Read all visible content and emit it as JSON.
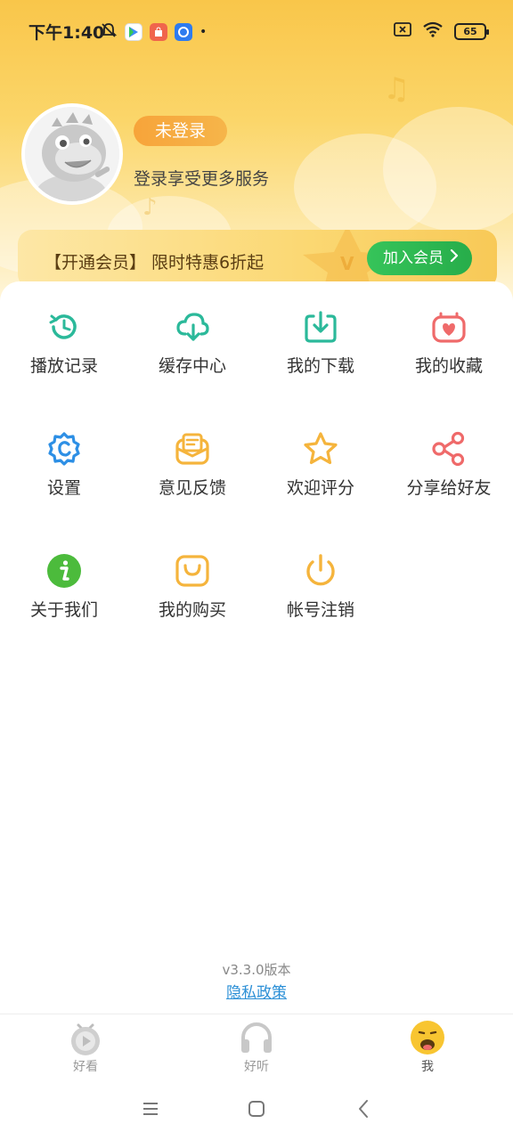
{
  "status_bar": {
    "time": "下午1:40",
    "battery": "65"
  },
  "profile": {
    "login_status": "未登录",
    "login_hint": "登录享受更多服务"
  },
  "vip_banner": {
    "text": "【开通会员】 限时特惠6折起",
    "button_label": "加入会员"
  },
  "menu": {
    "items": [
      {
        "label": "播放记录",
        "icon": "history-icon",
        "color": "#2bb99a"
      },
      {
        "label": "缓存中心",
        "icon": "cloud-download-icon",
        "color": "#2bb99a"
      },
      {
        "label": "我的下载",
        "icon": "download-icon",
        "color": "#2bb99a"
      },
      {
        "label": "我的收藏",
        "icon": "heart-bag-icon",
        "color": "#ef6a6a"
      },
      {
        "label": "设置",
        "icon": "gear-icon",
        "color": "#2d8fe5"
      },
      {
        "label": "意见反馈",
        "icon": "feedback-mail-icon",
        "color": "#f5b43c"
      },
      {
        "label": "欢迎评分",
        "icon": "star-icon",
        "color": "#f5b43c"
      },
      {
        "label": "分享给好友",
        "icon": "share-icon",
        "color": "#ef6a6a"
      },
      {
        "label": "关于我们",
        "icon": "info-icon",
        "color": "#4cbb3c"
      },
      {
        "label": "我的购买",
        "icon": "shopping-bag-icon",
        "color": "#f5b43c"
      },
      {
        "label": "帐号注销",
        "icon": "power-icon",
        "color": "#f5b43c"
      }
    ]
  },
  "footer": {
    "version": "v3.3.0版本",
    "privacy": "隐私政策"
  },
  "tabbar": {
    "tabs": [
      {
        "label": "好看",
        "icon": "tv-play-icon",
        "active": false
      },
      {
        "label": "好听",
        "icon": "headphones-icon",
        "active": false
      },
      {
        "label": "我",
        "icon": "face-icon",
        "active": true
      }
    ]
  }
}
